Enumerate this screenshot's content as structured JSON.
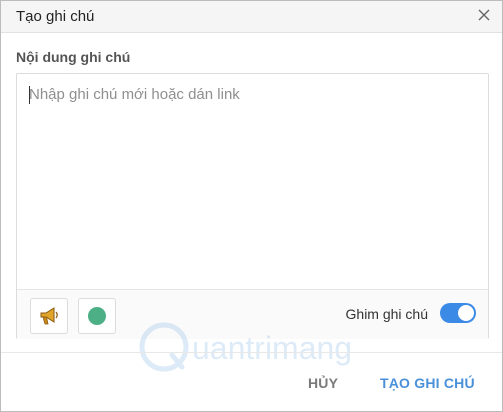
{
  "dialog": {
    "title": "Tạo ghi chú",
    "close_icon": "close-icon"
  },
  "note": {
    "label": "Nội dung ghi chú",
    "placeholder": "Nhập ghi chú mới hoặc dán link",
    "value": ""
  },
  "toolbar": {
    "reminder_icon": "megaphone-icon",
    "color_icon": "color-dot-icon",
    "note_color": "#4caf86",
    "pin_label": "Ghim ghi chú",
    "pin_enabled": true,
    "toggle_color": "#3b8be6"
  },
  "watermark": {
    "text": "uantrimang"
  },
  "footer": {
    "cancel_label": "HỦY",
    "create_label": "TẠO GHI CHÚ",
    "accent": "#4a90d9"
  }
}
